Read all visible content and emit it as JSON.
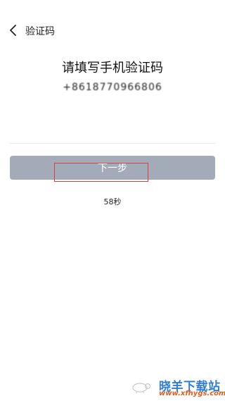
{
  "header": {
    "title": "验证码",
    "back_icon": "chevron-left-icon"
  },
  "main": {
    "heading": "请填写手机验证码",
    "phone_number": "+8618770966806",
    "code_input_value": "",
    "next_button_label": "下一步",
    "countdown": "58秒"
  },
  "watermark": {
    "text": "晓羊下载站",
    "url": "www.xfhygs.com"
  },
  "colors": {
    "button_bg": "#a3abb8",
    "highlight_border": "#e03a3a",
    "watermark_blue": "#2e7fd1",
    "watermark_orange": "#e45b1e"
  }
}
